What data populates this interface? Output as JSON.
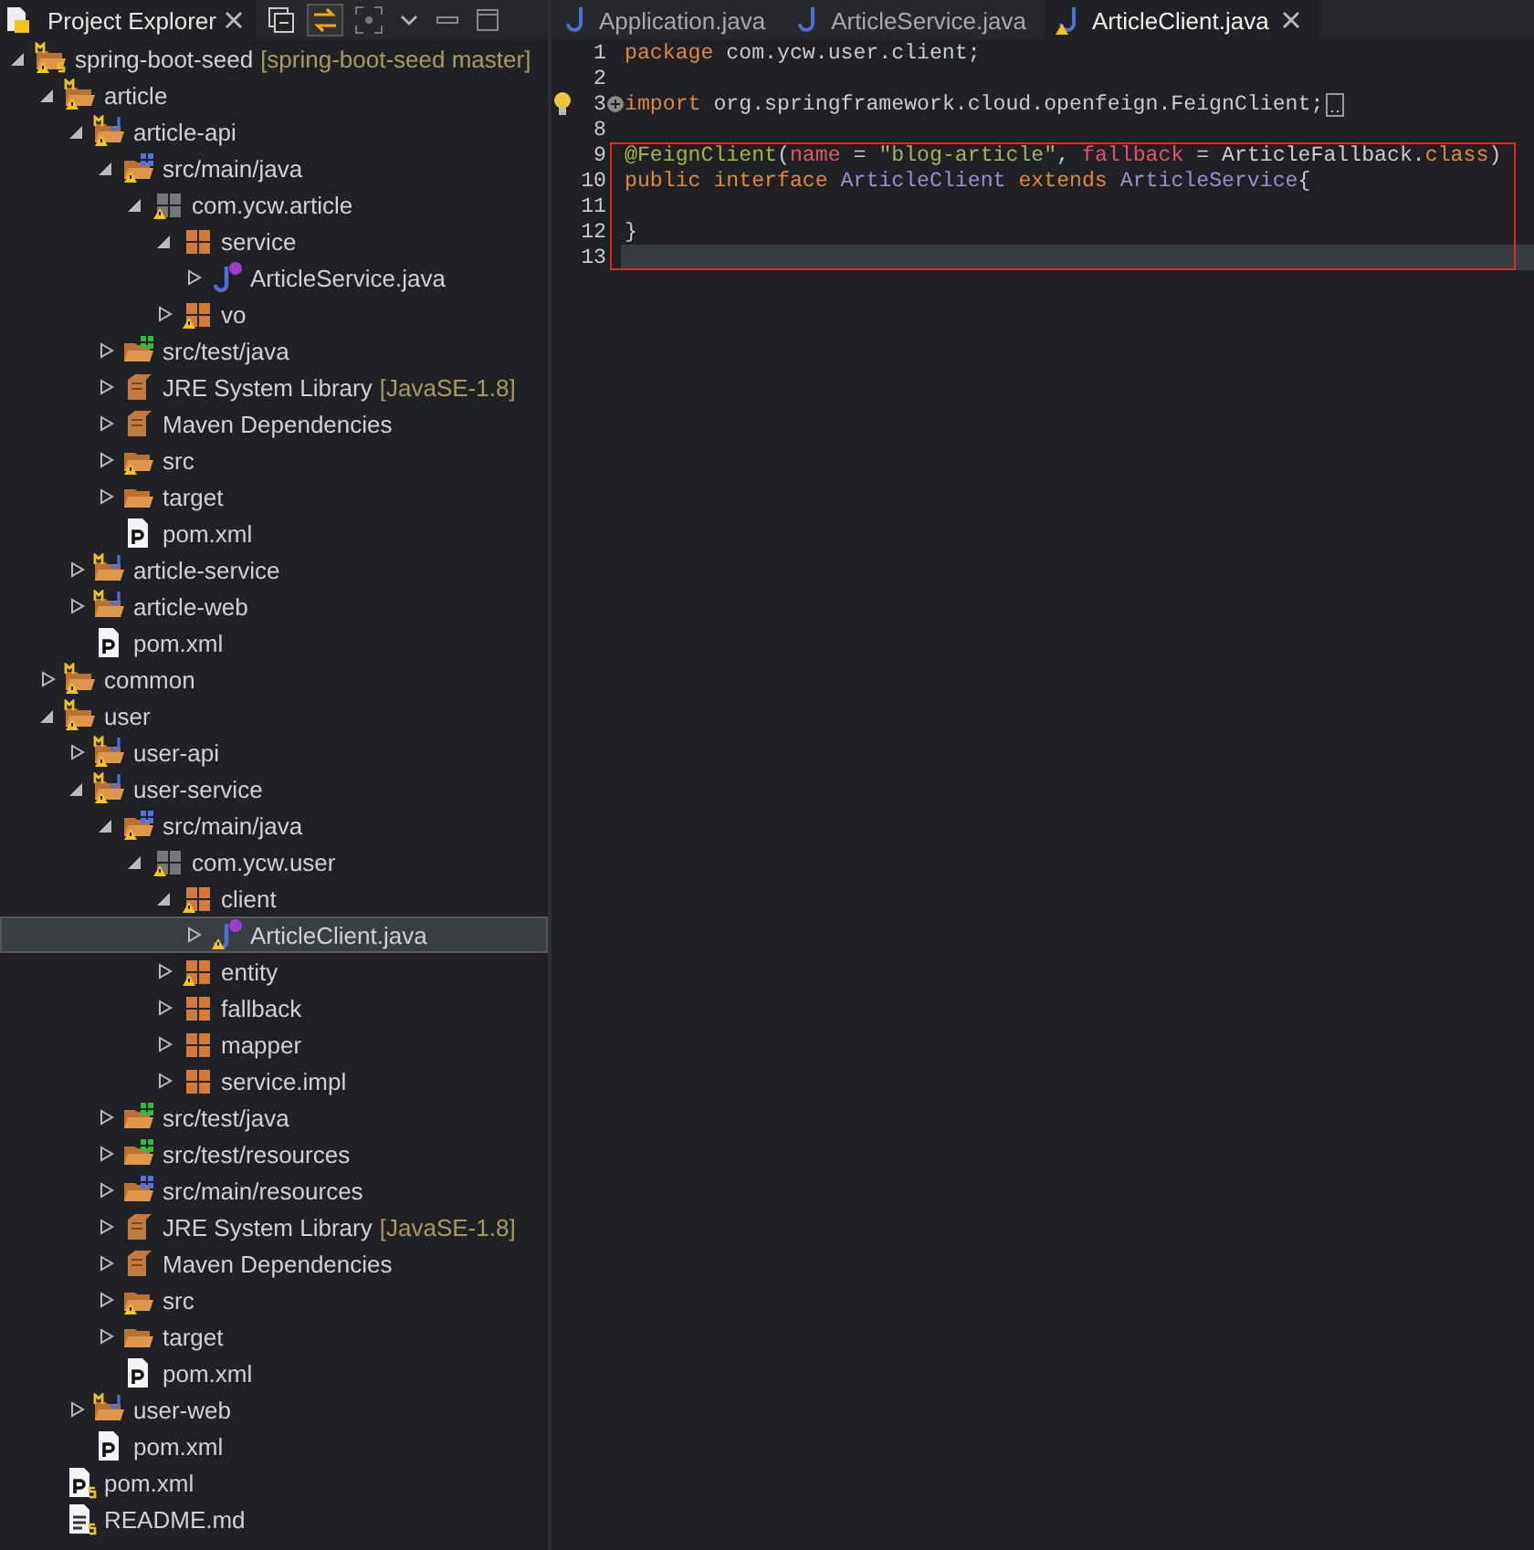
{
  "explorer": {
    "title": "Project Explorer",
    "toolbar": [
      {
        "kind": "collapse",
        "on": false
      },
      {
        "kind": "link",
        "on": true
      },
      {
        "kind": "focus",
        "on": false
      },
      {
        "kind": "menu",
        "on": false
      },
      {
        "kind": "minimize",
        "on": false
      },
      {
        "kind": "maximize",
        "on": false
      }
    ],
    "tree": {
      "items": [
        {
          "label": "spring-boot-seed",
          "decoration": "[spring-boot-seed master]",
          "kind": "root-project",
          "warning": true,
          "expanded": true,
          "selected": false,
          "children": [
            {
              "label": "article",
              "kind": "project",
              "warning": true,
              "expanded": true,
              "selected": false,
              "children": [
                {
                  "label": "article-api",
                  "kind": "module",
                  "warning": true,
                  "expanded": true,
                  "selected": false,
                  "children": [
                    {
                      "label": "src/main/java",
                      "kind": "source-folder",
                      "warning": true,
                      "expanded": true,
                      "selected": false,
                      "children": [
                        {
                          "label": "com.ycw.article",
                          "kind": "package-root",
                          "warning": true,
                          "expanded": true,
                          "selected": false,
                          "children": [
                            {
                              "label": "service",
                              "kind": "package",
                              "warning": false,
                              "expanded": true,
                              "selected": false,
                              "children": [
                                {
                                  "label": "ArticleService.java",
                                  "kind": "interface",
                                  "warning": false,
                                  "expanded": false,
                                  "selected": false
                                }
                              ]
                            },
                            {
                              "label": "vo",
                              "kind": "package",
                              "warning": true,
                              "expanded": false,
                              "selected": false
                            }
                          ]
                        }
                      ]
                    },
                    {
                      "label": "src/test/java",
                      "kind": "test-folder",
                      "warning": false,
                      "expanded": false,
                      "selected": false
                    },
                    {
                      "label": "JRE System Library",
                      "decoration": "[JavaSE-1.8]",
                      "kind": "library",
                      "warning": false,
                      "expanded": false,
                      "selected": false
                    },
                    {
                      "label": "Maven Dependencies",
                      "kind": "library",
                      "warning": false,
                      "expanded": false,
                      "selected": false
                    },
                    {
                      "label": "src",
                      "kind": "folder",
                      "warning": true,
                      "expanded": false,
                      "selected": false
                    },
                    {
                      "label": "target",
                      "kind": "folder",
                      "warning": false,
                      "expanded": false,
                      "selected": false
                    },
                    {
                      "label": "pom.xml",
                      "kind": "pom",
                      "warning": false,
                      "selected": false
                    }
                  ]
                },
                {
                  "label": "article-service",
                  "kind": "module",
                  "warning": false,
                  "expanded": false,
                  "selected": false
                },
                {
                  "label": "article-web",
                  "kind": "module",
                  "warning": false,
                  "expanded": false,
                  "selected": false
                },
                {
                  "label": "pom.xml",
                  "kind": "pom",
                  "warning": false,
                  "selected": false
                }
              ]
            },
            {
              "label": "common",
              "kind": "project",
              "warning": true,
              "expanded": false,
              "selected": false
            },
            {
              "label": "user",
              "kind": "project",
              "warning": true,
              "expanded": true,
              "selected": false,
              "children": [
                {
                  "label": "user-api",
                  "kind": "module",
                  "warning": true,
                  "expanded": false,
                  "selected": false
                },
                {
                  "label": "user-service",
                  "kind": "module",
                  "warning": true,
                  "expanded": true,
                  "selected": false,
                  "children": [
                    {
                      "label": "src/main/java",
                      "kind": "source-folder",
                      "warning": true,
                      "expanded": true,
                      "selected": false,
                      "children": [
                        {
                          "label": "com.ycw.user",
                          "kind": "package-root",
                          "warning": true,
                          "expanded": true,
                          "selected": false,
                          "children": [
                            {
                              "label": "client",
                              "kind": "package",
                              "warning": true,
                              "expanded": true,
                              "selected": false,
                              "children": [
                                {
                                  "label": "ArticleClient.java",
                                  "kind": "interface",
                                  "warning": true,
                                  "expanded": false,
                                  "selected": true
                                }
                              ]
                            },
                            {
                              "label": "entity",
                              "kind": "package",
                              "warning": true,
                              "expanded": false,
                              "selected": false
                            },
                            {
                              "label": "fallback",
                              "kind": "package",
                              "warning": false,
                              "expanded": false,
                              "selected": false
                            },
                            {
                              "label": "mapper",
                              "kind": "package",
                              "warning": false,
                              "expanded": false,
                              "selected": false
                            },
                            {
                              "label": "service.impl",
                              "kind": "package",
                              "warning": false,
                              "expanded": false,
                              "selected": false
                            }
                          ]
                        }
                      ]
                    },
                    {
                      "label": "src/test/java",
                      "kind": "test-folder",
                      "warning": false,
                      "expanded": false,
                      "selected": false
                    },
                    {
                      "label": "src/test/resources",
                      "kind": "test-folder",
                      "warning": false,
                      "expanded": false,
                      "selected": false
                    },
                    {
                      "label": "src/main/resources",
                      "kind": "source-folder",
                      "warning": false,
                      "expanded": false,
                      "selected": false
                    },
                    {
                      "label": "JRE System Library",
                      "decoration": "[JavaSE-1.8]",
                      "kind": "library",
                      "warning": false,
                      "expanded": false,
                      "selected": false
                    },
                    {
                      "label": "Maven Dependencies",
                      "kind": "library",
                      "warning": false,
                      "expanded": false,
                      "selected": false
                    },
                    {
                      "label": "src",
                      "kind": "folder",
                      "warning": true,
                      "expanded": false,
                      "selected": false
                    },
                    {
                      "label": "target",
                      "kind": "folder",
                      "warning": false,
                      "expanded": false,
                      "selected": false
                    },
                    {
                      "label": "pom.xml",
                      "kind": "pom",
                      "warning": false,
                      "selected": false
                    }
                  ]
                },
                {
                  "label": "user-web",
                  "kind": "module",
                  "warning": false,
                  "expanded": false,
                  "selected": false
                },
                {
                  "label": "pom.xml",
                  "kind": "pom",
                  "warning": false,
                  "selected": false
                }
              ]
            },
            {
              "label": "pom.xml",
              "kind": "root-pom",
              "warning": false,
              "selected": false
            },
            {
              "label": "README.md",
              "kind": "readme",
              "warning": false,
              "selected": false
            }
          ]
        }
      ]
    }
  },
  "editor": {
    "tabs": [
      {
        "label": "Application.java",
        "warning": false,
        "selected": false
      },
      {
        "label": "ArticleService.java",
        "warning": false,
        "selected": false
      },
      {
        "label": "ArticleClient.java",
        "warning": true,
        "selected": true
      }
    ],
    "lines": [
      {
        "number": "1",
        "boxed": false,
        "current": false,
        "bulb": false,
        "folded": false,
        "tokens": [
          {
            "text": "package",
            "kind": "keyword"
          },
          {
            "text": " com.ycw.user.client;",
            "kind": "plain"
          }
        ]
      },
      {
        "number": "2",
        "boxed": false,
        "current": false,
        "bulb": false,
        "folded": false
      },
      {
        "number": "3",
        "boxed": false,
        "current": false,
        "bulb": true,
        "folded": true,
        "tokens": [
          {
            "text": "import",
            "kind": "keyword"
          },
          {
            "text": " org.springframework.cloud.openfeign.FeignClient;",
            "kind": "plain"
          }
        ]
      },
      {
        "number": "8",
        "boxed": false,
        "current": false,
        "bulb": false,
        "folded": false
      },
      {
        "number": "9",
        "boxed": true,
        "current": false,
        "bulb": false,
        "folded": false,
        "tokens": [
          {
            "text": "@FeignClient",
            "kind": "annotation"
          },
          {
            "text": "(",
            "kind": "plain"
          },
          {
            "text": "name",
            "kind": "attribute"
          },
          {
            "text": " = ",
            "kind": "plain"
          },
          {
            "text": "\"blog-article\"",
            "kind": "string"
          },
          {
            "text": ", ",
            "kind": "plain"
          },
          {
            "text": "fallback",
            "kind": "attribute"
          },
          {
            "text": " = ArticleFallback.",
            "kind": "plain"
          },
          {
            "text": "class",
            "kind": "keyword"
          },
          {
            "text": ")",
            "kind": "plain"
          }
        ]
      },
      {
        "number": "10",
        "boxed": true,
        "current": false,
        "bulb": false,
        "folded": false,
        "tokens": [
          {
            "text": "public interface",
            "kind": "keyword"
          },
          {
            "text": " ArticleClient",
            "kind": "type"
          },
          {
            "text": " extends",
            "kind": "keyword"
          },
          {
            "text": " ArticleService",
            "kind": "type"
          },
          {
            "text": "{",
            "kind": "plain"
          }
        ]
      },
      {
        "number": "11",
        "boxed": true,
        "current": false,
        "bulb": false,
        "folded": false
      },
      {
        "number": "12",
        "boxed": true,
        "current": false,
        "bulb": false,
        "folded": false,
        "tokens": [
          {
            "text": "}",
            "kind": "plain"
          }
        ]
      },
      {
        "number": "13",
        "boxed": true,
        "current": true,
        "bulb": false,
        "folded": false
      }
    ]
  }
}
